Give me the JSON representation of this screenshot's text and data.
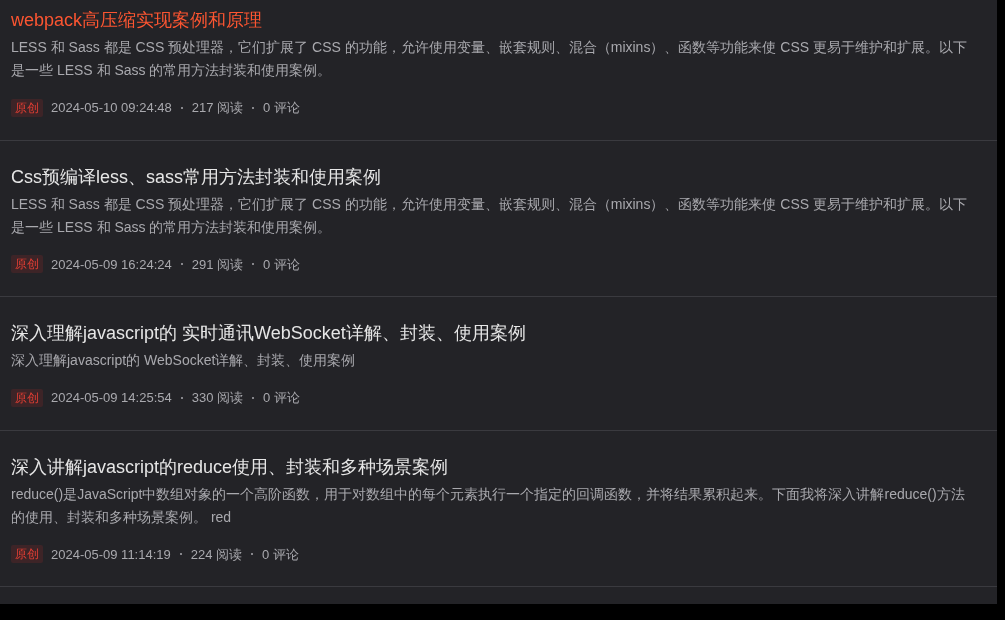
{
  "articles": [
    {
      "title": "webpack高压缩实现案例和原理",
      "highlighted": true,
      "summary": "LESS 和 Sass 都是 CSS 预处理器，它们扩展了 CSS 的功能，允许使用变量、嵌套规则、混合（mixins）、函数等功能来使 CSS 更易于维护和扩展。以下是一些 LESS 和 Sass 的常用方法封装和使用案例。",
      "tag": "原创",
      "date": "2024-05-10 09:24:48",
      "reads": "217 阅读",
      "comments": "0 评论"
    },
    {
      "title": "Css预编译less、sass常用方法封装和使用案例",
      "highlighted": false,
      "summary": "LESS 和 Sass 都是 CSS 预处理器，它们扩展了 CSS 的功能，允许使用变量、嵌套规则、混合（mixins）、函数等功能来使 CSS 更易于维护和扩展。以下是一些 LESS 和 Sass 的常用方法封装和使用案例。",
      "tag": "原创",
      "date": "2024-05-09 16:24:24",
      "reads": "291 阅读",
      "comments": "0 评论"
    },
    {
      "title": "深入理解javascript的 实时通讯WebSocket详解、封装、使用案例",
      "highlighted": false,
      "summary": "深入理解javascript的 WebSocket详解、封装、使用案例",
      "tag": "原创",
      "date": "2024-05-09 14:25:54",
      "reads": "330 阅读",
      "comments": "0 评论"
    },
    {
      "title": "深入讲解javascript的reduce使用、封装和多种场景案例",
      "highlighted": false,
      "summary": "reduce()是JavaScript中数组对象的一个高阶函数，用于对数组中的每个元素执行一个指定的回调函数，并将结果累积起来。下面我将深入讲解reduce()方法的使用、封装和多种场景案例。 red",
      "tag": "原创",
      "date": "2024-05-09 11:14:19",
      "reads": "224 阅读",
      "comments": "0 评论"
    }
  ]
}
